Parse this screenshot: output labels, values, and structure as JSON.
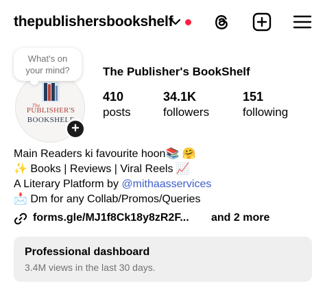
{
  "header": {
    "username": "thepublishersbookshelf",
    "icons": [
      "chevron-down-icon",
      "notification-dot",
      "threads-icon",
      "create-icon",
      "menu-icon"
    ],
    "accent_red": "#ff1f3d"
  },
  "note": {
    "line1": "What's on",
    "line2": "your mind?"
  },
  "avatar": {
    "logo_the": "The",
    "logo_publishers": "PUBLISHER'S",
    "logo_bookshelf": "BOOKSHELF",
    "add_icon": "+"
  },
  "profile": {
    "display_name": "The Publisher's BookShelf",
    "stats": {
      "posts": {
        "count": "410",
        "label": "posts"
      },
      "followers": {
        "count": "34.1K",
        "label": "followers"
      },
      "following": {
        "count": "151",
        "label": "following"
      }
    }
  },
  "bio": {
    "line1": "Main Readers ki favourite hoon📚 🤗",
    "line2": "✨ Books | Reviews | Viral Reels 📈",
    "line3_prefix": "A Literary Platform by ",
    "line3_mention": "@mithaasservices",
    "line4": "📩 Dm for any Collab/Promos/Queries",
    "mention_color": "#3d5fc9"
  },
  "link": {
    "text": "forms.gle/MJ1f8Ck18y8zR2F...",
    "more": "and 2 more"
  },
  "dashboard": {
    "title": "Professional dashboard",
    "subtitle": "3.4M views in the last 30 days."
  }
}
